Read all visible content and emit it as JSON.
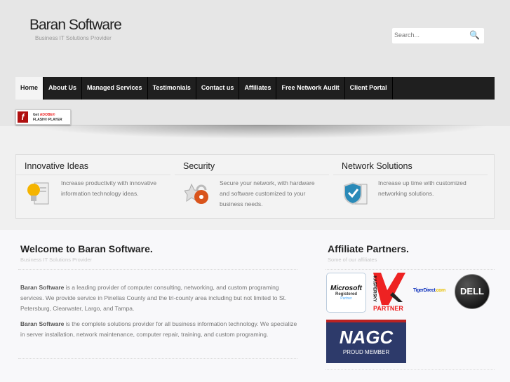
{
  "header": {
    "title": "Baran Software",
    "tagline": "Business IT Solutions Provider",
    "search_placeholder": "Search..."
  },
  "nav": [
    {
      "label": "Home",
      "active": true
    },
    {
      "label": "About Us"
    },
    {
      "label": "Managed Services"
    },
    {
      "label": "Testimonials"
    },
    {
      "label": "Contact us"
    },
    {
      "label": "Affiliates"
    },
    {
      "label": "Free Network Audit"
    },
    {
      "label": "Client Portal"
    }
  ],
  "flash_badge": {
    "line1a": "Get ",
    "line1b": "ADOBE®",
    "line2": "FLASH® PLAYER"
  },
  "features": [
    {
      "title": "Innovative Ideas",
      "text": "Increase productivity with innovative information technology ideas.",
      "icon": "lightbulb-icon"
    },
    {
      "title": "Security",
      "text": "Secure your network, with hardware and software customized to your business needs.",
      "icon": "lock-icon"
    },
    {
      "title": "Network Solutions",
      "text": "Increase up time with customized networking solutions.",
      "icon": "shield-server-icon"
    }
  ],
  "welcome": {
    "title": "Welcome to Baran Software.",
    "subtitle": "Business IT Solutions Provider",
    "p1_bold": "Baran Software",
    "p1": " is a leading provider of computer consulting, networking, and custom programing services. We provide service in Pinellas County and the tri-county area including but not limited to St. Petersburg, Clearwater, Largo, and Tampa.",
    "p2_bold": "Baran Software",
    "p2": " is the complete solutions provider for all business information technology. We specialize in server installation, network maintenance, computer repair, training, and custom programing."
  },
  "affiliates": {
    "title": "Affiliate Partners.",
    "subtitle": "Some of our affiliates",
    "logos": {
      "microsoft": "Microsoft",
      "ms_reg": "Registered",
      "ms_partner": "Partner",
      "kaspersky": "KASPERSKY",
      "kasp_partner": "PARTNER",
      "tiger": "TigerDirect",
      "tiger_com": ".com",
      "dell": "DELL",
      "nagc": "NAGC",
      "nagc_sub": "PROUD MEMBER"
    }
  }
}
